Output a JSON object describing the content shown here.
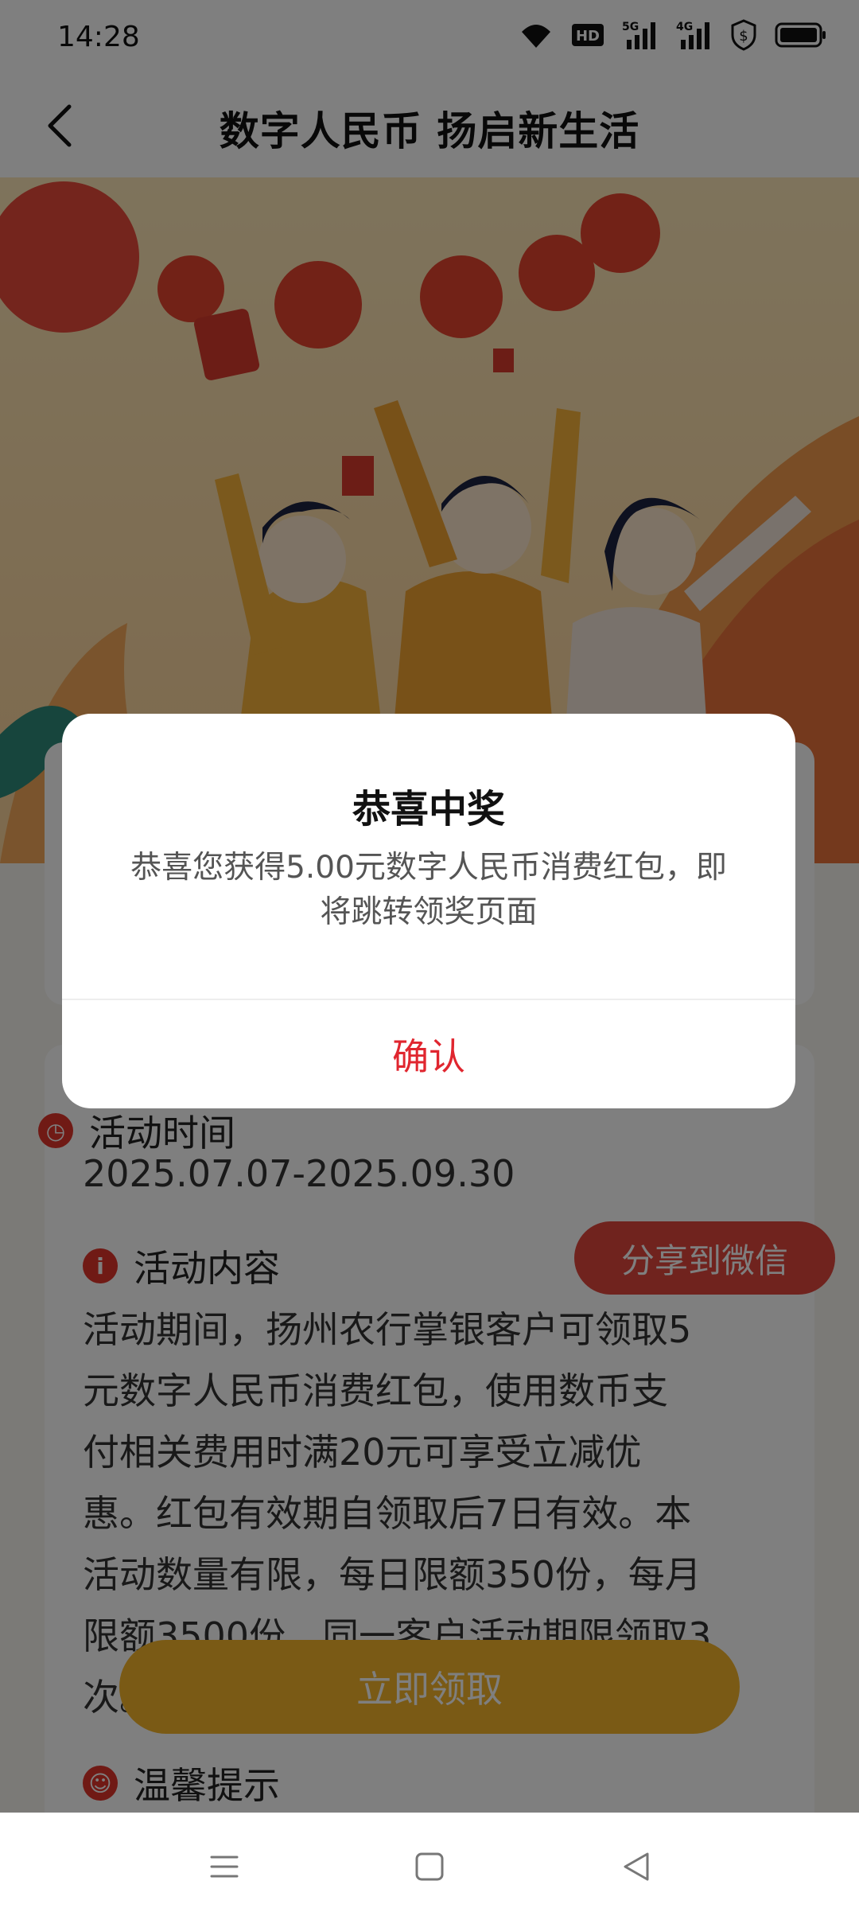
{
  "status_bar": {
    "time": "14:28",
    "hd_label": "HD",
    "net1": "5G",
    "net2": "4G"
  },
  "header": {
    "title": "数字人民币 扬启新生活"
  },
  "activity": {
    "time_title": "活动时间",
    "date_range": "2025.07.07-2025.09.30",
    "content_title": "活动内容",
    "content_lines": [
      "活动期间，扬州农行掌银客户可领取5",
      "元数字人民币消费红包，使用数币支",
      "付相关费用时满20元可享受立减优",
      "惠。红包有效期自领取后7日有效。本",
      "活动数量有限，每日限额350份，每月",
      "限额3500份，同一客户活动期限领取3",
      "次。"
    ],
    "tips_title": "温馨提示",
    "share_label": "分享到微信",
    "claim_label": "立即领取"
  },
  "dialog": {
    "title": "恭喜中奖",
    "message_line1": "恭喜您获得5.00元数字人民币消费红包，即",
    "message_line2": "将跳转领奖页面",
    "confirm_label": "确认"
  },
  "colors": {
    "accent_red": "#e0262f",
    "button_yellow": "#f5b52a",
    "share_red": "#e0463d"
  },
  "icons": [
    "back-arrow-icon",
    "wifi-icon",
    "signal-icon",
    "shield-icon",
    "battery-icon",
    "menu-icon",
    "home-icon",
    "back-triangle-icon"
  ]
}
